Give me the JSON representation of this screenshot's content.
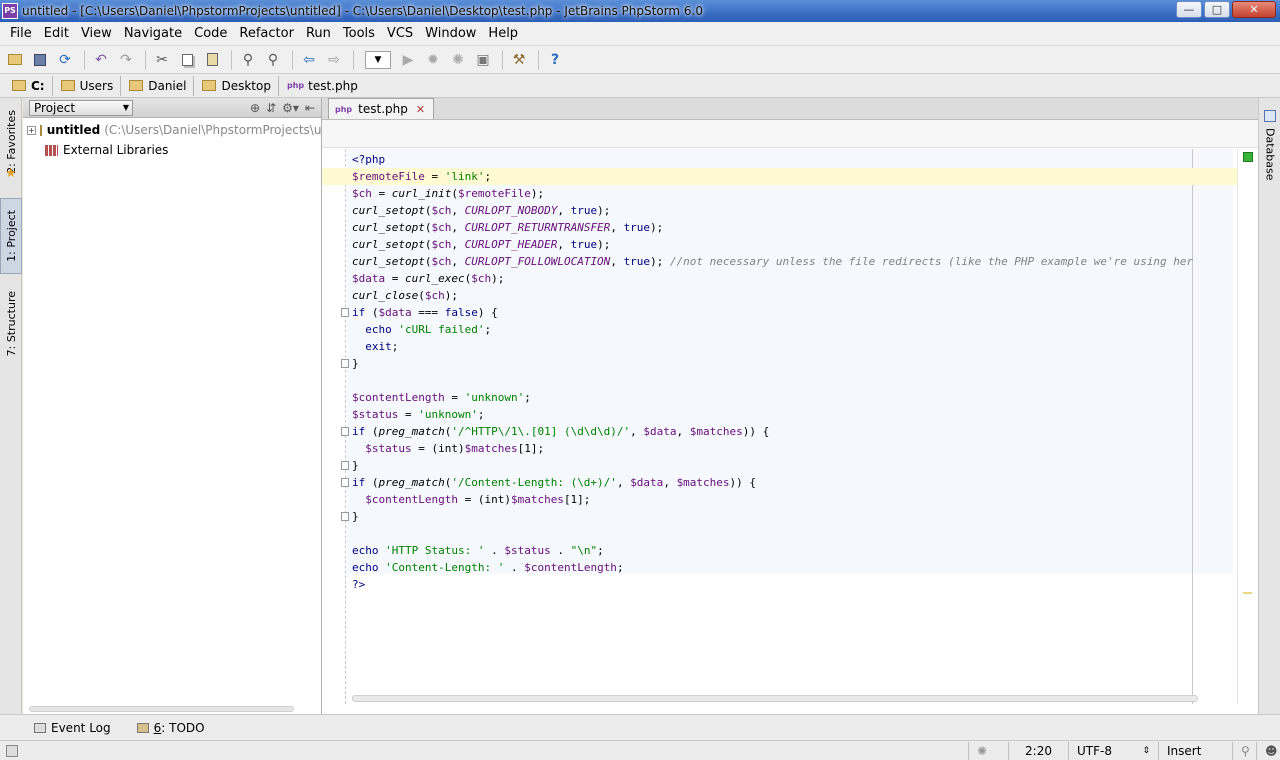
{
  "window": {
    "title": "untitled - [C:\\Users\\Daniel\\PhpstormProjects\\untitled] - C:\\Users\\Daniel\\Desktop\\test.php - JetBrains PhpStorm 6.0",
    "controls": [
      "minimize",
      "maximize",
      "close"
    ]
  },
  "menu": {
    "items": [
      {
        "label": "File"
      },
      {
        "label": "Edit"
      },
      {
        "label": "View"
      },
      {
        "label": "Navigate"
      },
      {
        "label": "Code"
      },
      {
        "label": "Refactor"
      },
      {
        "label": "Run"
      },
      {
        "label": "Tools"
      },
      {
        "label": "VCS"
      },
      {
        "label": "Window"
      },
      {
        "label": "Help"
      }
    ]
  },
  "toolbar": {
    "icons": [
      "open-icon",
      "save-icon",
      "sync-icon",
      "undo-icon",
      "redo-icon",
      "cut-icon",
      "copy-icon",
      "paste-icon",
      "find-icon",
      "replace-icon",
      "back-icon",
      "forward-icon",
      "run-config-dropdown",
      "run-icon",
      "debug-icon",
      "coverage-icon",
      "stop-icon",
      "settings-icon",
      "help-icon"
    ]
  },
  "navbar": {
    "crumbs": [
      {
        "label": "C:",
        "icon": "folder-icon"
      },
      {
        "label": "Users",
        "icon": "folder-icon"
      },
      {
        "label": "Daniel",
        "icon": "folder-icon"
      },
      {
        "label": "Desktop",
        "icon": "folder-icon"
      },
      {
        "label": "test.php",
        "icon": "php-file-icon"
      }
    ]
  },
  "left_strip": {
    "tabs": [
      {
        "label": "2: Favorites"
      },
      {
        "label": "1: Project",
        "active": true
      },
      {
        "label": "7: Structure"
      }
    ]
  },
  "right_strip": {
    "tabs": [
      {
        "label": "Database"
      }
    ]
  },
  "project_panel": {
    "selector": "Project",
    "tree": [
      {
        "name": "untitled",
        "path": "(C:\\Users\\Daniel\\PhpstormProjects\\untitled)",
        "expanded": false
      },
      {
        "name": "External Libraries"
      }
    ]
  },
  "editor": {
    "tab": {
      "label": "test.php"
    },
    "current_line": 2,
    "lines": [
      [
        {
          "t": "<?php",
          "c": "kw"
        }
      ],
      [
        {
          "t": "$remoteFile",
          "c": "v"
        },
        {
          "t": " = "
        },
        {
          "t": "'link'",
          "c": "s"
        },
        {
          "t": ";"
        }
      ],
      [
        {
          "t": "$ch",
          "c": "v"
        },
        {
          "t": " = "
        },
        {
          "t": "curl_init",
          "c": "f"
        },
        {
          "t": "("
        },
        {
          "t": "$remoteFile",
          "c": "v"
        },
        {
          "t": ");"
        }
      ],
      [
        {
          "t": "curl_setopt",
          "c": "f"
        },
        {
          "t": "("
        },
        {
          "t": "$ch",
          "c": "v"
        },
        {
          "t": ", "
        },
        {
          "t": "CURLOPT_NOBODY",
          "c": "c"
        },
        {
          "t": ", "
        },
        {
          "t": "true",
          "c": "kw"
        },
        {
          "t": ");"
        }
      ],
      [
        {
          "t": "curl_setopt",
          "c": "f"
        },
        {
          "t": "("
        },
        {
          "t": "$ch",
          "c": "v"
        },
        {
          "t": ", "
        },
        {
          "t": "CURLOPT_RETURNTRANSFER",
          "c": "c"
        },
        {
          "t": ", "
        },
        {
          "t": "true",
          "c": "kw"
        },
        {
          "t": ");"
        }
      ],
      [
        {
          "t": "curl_setopt",
          "c": "f"
        },
        {
          "t": "("
        },
        {
          "t": "$ch",
          "c": "v"
        },
        {
          "t": ", "
        },
        {
          "t": "CURLOPT_HEADER",
          "c": "c"
        },
        {
          "t": ", "
        },
        {
          "t": "true",
          "c": "kw"
        },
        {
          "t": ");"
        }
      ],
      [
        {
          "t": "curl_setopt",
          "c": "f"
        },
        {
          "t": "("
        },
        {
          "t": "$ch",
          "c": "v"
        },
        {
          "t": ", "
        },
        {
          "t": "CURLOPT_FOLLOWLOCATION",
          "c": "c"
        },
        {
          "t": ", "
        },
        {
          "t": "true",
          "c": "kw"
        },
        {
          "t": "); "
        },
        {
          "t": "//not necessary unless the file redirects (like the PHP example we're using her",
          "c": "cm"
        }
      ],
      [
        {
          "t": "$data",
          "c": "v"
        },
        {
          "t": " = "
        },
        {
          "t": "curl_exec",
          "c": "f"
        },
        {
          "t": "("
        },
        {
          "t": "$ch",
          "c": "v"
        },
        {
          "t": ");"
        }
      ],
      [
        {
          "t": "curl_close",
          "c": "f"
        },
        {
          "t": "("
        },
        {
          "t": "$ch",
          "c": "v"
        },
        {
          "t": ");"
        }
      ],
      [
        {
          "t": "if",
          "c": "kw"
        },
        {
          "t": " ("
        },
        {
          "t": "$data",
          "c": "v"
        },
        {
          "t": " === "
        },
        {
          "t": "false",
          "c": "kw"
        },
        {
          "t": ") {"
        }
      ],
      [
        {
          "t": "  "
        },
        {
          "t": "echo",
          "c": "kw"
        },
        {
          "t": " "
        },
        {
          "t": "'cURL failed'",
          "c": "s"
        },
        {
          "t": ";"
        }
      ],
      [
        {
          "t": "  "
        },
        {
          "t": "exit",
          "c": "kw"
        },
        {
          "t": ";"
        }
      ],
      [
        {
          "t": "}"
        }
      ],
      [
        {
          "t": ""
        }
      ],
      [
        {
          "t": "$contentLength",
          "c": "v"
        },
        {
          "t": " = "
        },
        {
          "t": "'unknown'",
          "c": "s"
        },
        {
          "t": ";"
        }
      ],
      [
        {
          "t": "$status",
          "c": "v"
        },
        {
          "t": " = "
        },
        {
          "t": "'unknown'",
          "c": "s"
        },
        {
          "t": ";"
        }
      ],
      [
        {
          "t": "if",
          "c": "kw"
        },
        {
          "t": " ("
        },
        {
          "t": "preg_match",
          "c": "f"
        },
        {
          "t": "("
        },
        {
          "t": "'/^HTTP\\/1\\.[01] (\\d\\d\\d)/'",
          "c": "s"
        },
        {
          "t": ", "
        },
        {
          "t": "$data",
          "c": "v"
        },
        {
          "t": ", "
        },
        {
          "t": "$matches",
          "c": "v"
        },
        {
          "t": ")) {"
        }
      ],
      [
        {
          "t": "  "
        },
        {
          "t": "$status",
          "c": "v"
        },
        {
          "t": " = (int)"
        },
        {
          "t": "$matches",
          "c": "v"
        },
        {
          "t": "[1];"
        }
      ],
      [
        {
          "t": "}"
        }
      ],
      [
        {
          "t": "if",
          "c": "kw"
        },
        {
          "t": " ("
        },
        {
          "t": "preg_match",
          "c": "f"
        },
        {
          "t": "("
        },
        {
          "t": "'/Content-Length: (\\d+)/'",
          "c": "s"
        },
        {
          "t": ", "
        },
        {
          "t": "$data",
          "c": "v"
        },
        {
          "t": ", "
        },
        {
          "t": "$matches",
          "c": "v"
        },
        {
          "t": ")) {"
        }
      ],
      [
        {
          "t": "  "
        },
        {
          "t": "$contentLength",
          "c": "v"
        },
        {
          "t": " = (int)"
        },
        {
          "t": "$matches",
          "c": "v"
        },
        {
          "t": "[1];"
        }
      ],
      [
        {
          "t": "}"
        }
      ],
      [
        {
          "t": ""
        }
      ],
      [
        {
          "t": "echo",
          "c": "kw"
        },
        {
          "t": " "
        },
        {
          "t": "'HTTP Status: '",
          "c": "s"
        },
        {
          "t": " . "
        },
        {
          "t": "$status",
          "c": "v"
        },
        {
          "t": " . "
        },
        {
          "t": "\"\\n\"",
          "c": "s"
        },
        {
          "t": ";"
        }
      ],
      [
        {
          "t": "echo",
          "c": "kw"
        },
        {
          "t": " "
        },
        {
          "t": "'Content-Length: '",
          "c": "s"
        },
        {
          "t": " . "
        },
        {
          "t": "$contentLength",
          "c": "v"
        },
        {
          "t": ";"
        }
      ],
      [
        {
          "t": "?>",
          "c": "kw"
        }
      ]
    ],
    "fold_lines": [
      10,
      13,
      17,
      19,
      20,
      22
    ]
  },
  "bottom_bar": {
    "event_log": "Event Log",
    "todo_num": "6",
    "todo_rest": ": TODO"
  },
  "status": {
    "position": "2:20",
    "encoding": "UTF-8",
    "mode": "Insert"
  }
}
